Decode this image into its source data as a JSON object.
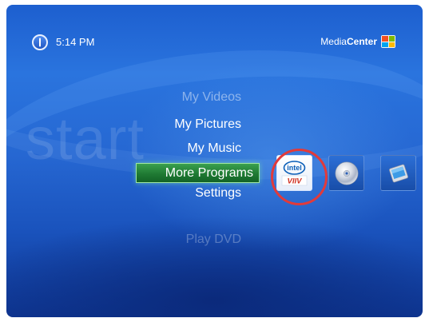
{
  "status_bar": {
    "time": "5:14 PM"
  },
  "brand": {
    "part1": "Media",
    "part2": "Center"
  },
  "start_label": "start",
  "menu": {
    "items": [
      {
        "label": "My Videos",
        "state": "dimmed"
      },
      {
        "label": "My Pictures",
        "state": "normal"
      },
      {
        "label": "My Music",
        "state": "normal"
      },
      {
        "label": "More Programs",
        "state": "selected"
      },
      {
        "label": "Settings",
        "state": "normal"
      },
      {
        "label": "Play DVD",
        "state": "faded"
      }
    ]
  },
  "program_tiles": [
    {
      "icon": "intel-viiv-icon",
      "label_top": "intel",
      "label_bottom": "VIIV",
      "highlighted": true
    },
    {
      "icon": "dvd-disc-icon"
    },
    {
      "icon": "mobile-device-icon"
    }
  ],
  "colors": {
    "selection_green": "#1f7a33",
    "highlight_ring": "#e23a3a",
    "background_blue": "#2667d2"
  }
}
